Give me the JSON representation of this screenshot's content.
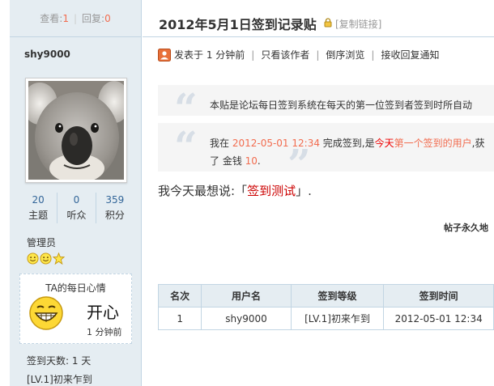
{
  "thread_stats": {
    "views_label": "查看:",
    "views": "1",
    "replies_label": "回复:",
    "replies": "0"
  },
  "author": {
    "name": "shy9000",
    "counts": [
      {
        "value": "20",
        "label": "主题"
      },
      {
        "value": "0",
        "label": "听众"
      },
      {
        "value": "359",
        "label": "积分"
      }
    ],
    "role": "管理员",
    "mood": {
      "title": "TA的每日心情",
      "text": "开心",
      "time": "1 分钟前"
    },
    "checkin_days": "签到天数: 1 天",
    "checkin_level": "[LV.1]初来乍到"
  },
  "thread": {
    "title": "2012年5月1日签到记录贴",
    "copy_link": "[复制链接]"
  },
  "post_meta": {
    "posted": "发表于 1 分钟前",
    "only_author": "只看该作者",
    "reverse": "倒序浏览",
    "notify": "接收回复通知"
  },
  "quote1": {
    "text": "本贴是论坛每日签到系统在每天的第一位签到者签到时所自动"
  },
  "quote2": {
    "prefix": "我在 ",
    "time": "2012-05-01 12:34",
    "mid": " 完成签到,是",
    "today": "今天",
    "first": "第一个签到的用户",
    "suffix": ",获",
    "line2_prefix": "了 金钱 ",
    "money": "10",
    "line2_suffix": "."
  },
  "say": {
    "prefix": "我今天最想说:「",
    "content": "签到测试",
    "suffix": "」."
  },
  "slogan": "帖子永久地",
  "table": {
    "headers": [
      "名次",
      "用户名",
      "签到等级",
      "签到时间"
    ],
    "rows": [
      [
        "1",
        "shy9000",
        "[LV.1]初来乍到",
        "2012-05-01 12:34"
      ]
    ]
  },
  "icons": {
    "lock": "lock-icon",
    "post": "post-author-icon",
    "smileys": [
      "smiley-icon",
      "smiley-icon",
      "star-icon"
    ],
    "mood_face": "grin-face-icon"
  },
  "colors": {
    "accent": "#f26c4f",
    "link": "#336699",
    "border": "#c2d5e3",
    "sidebar_bg": "#e5edf2"
  }
}
